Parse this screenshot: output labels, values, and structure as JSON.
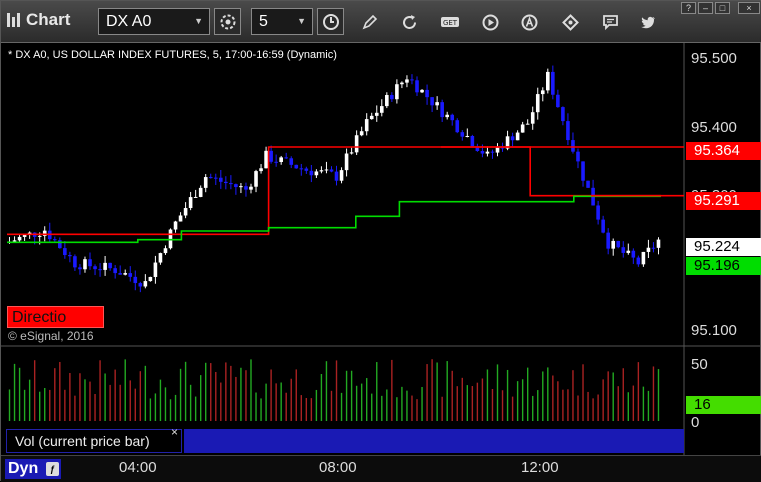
{
  "app": {
    "title": "Chart"
  },
  "toolbar": {
    "symbol": "DX A0",
    "interval": "5",
    "icons": [
      "settings-gear-icon",
      "clock-icon",
      "pencil-icon",
      "refresh-icon",
      "get-icon",
      "play-icon",
      "alert-a-icon",
      "diamond-icon",
      "comment-icon",
      "twitter-icon"
    ]
  },
  "window_controls": [
    "help",
    "minimize",
    "maximize",
    "close"
  ],
  "chart": {
    "caption": "* DX A0, US DOLLAR INDEX FUTURES, 5, 17:00-16:59 (Dynamic)",
    "copyright": "© eSignal, 2016",
    "direction_label": "Directio",
    "price_ticks": [
      "95.500",
      "95.400",
      "95.300",
      "95.100"
    ],
    "price_tags": [
      {
        "label": "95.364",
        "bg": "#ff0000",
        "fg": "#ffffff"
      },
      {
        "label": "95.291",
        "bg": "#ff0000",
        "fg": "#ffffff"
      },
      {
        "label": "95.224",
        "bg": "#ffffff",
        "fg": "#000000"
      },
      {
        "label": "95.196",
        "bg": "#00dd00",
        "fg": "#000000"
      }
    ],
    "volume": {
      "panel_label": "Vol (current price bar)",
      "ticks": [
        "50",
        "0"
      ],
      "current_tag": "16",
      "close_glyph": "×"
    },
    "time_ticks": [
      "04:00",
      "08:00",
      "12:00"
    ],
    "bottom_button": "Dyn",
    "colors": {
      "background": "#000000",
      "up_candle": "#ffffff",
      "down_candle": "#1a1aff",
      "red_ma": "#ff0000",
      "green_ma": "#00dd00",
      "vol_up": "#22aa22",
      "vol_down": "#aa2222",
      "accent_blue": "#1a1ab4"
    }
  },
  "chart_data": {
    "type": "line",
    "title": "* DX A0, US DOLLAR INDEX FUTURES, 5, 17:00-16:59 (Dynamic)",
    "x_ticks": [
      "04:00",
      "08:00",
      "12:00"
    ],
    "y_ticks": [
      95.5,
      95.4,
      95.3,
      95.1
    ],
    "ylim": [
      95.07,
      95.52
    ],
    "series": [
      {
        "name": "",
        "color": "#ff0000",
        "values": [
          95.233,
          95.233,
          95.233,
          95.233,
          95.233,
          95.233,
          95.364,
          95.364,
          95.364,
          95.364,
          95.364,
          95.364,
          95.291,
          95.291,
          95.291
        ]
      },
      {
        "name": "",
        "color": "#00dd00",
        "values": [
          95.221,
          95.221,
          95.221,
          95.225,
          95.238,
          95.238,
          95.243,
          95.243,
          95.26,
          95.282,
          95.282,
          95.282,
          95.282,
          95.29,
          95.29
        ]
      }
    ],
    "close_price": 95.224,
    "volume_current": 16,
    "volume_ylim": [
      0,
      50
    ]
  }
}
